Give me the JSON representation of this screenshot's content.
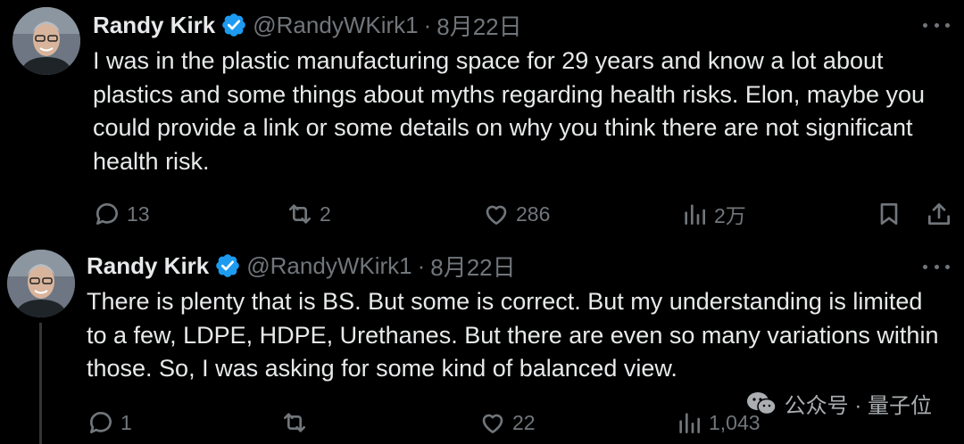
{
  "tweets": [
    {
      "name": "Randy Kirk",
      "handle": "@RandyWKirk1",
      "dot": "·",
      "date": "8月22日",
      "text": "I was in the plastic manufacturing space for 29 years and know a lot about plastics and some things about myths regarding health risks. Elon, maybe you could provide a link or some details on why you think there are not significant health risk.",
      "replies": "13",
      "retweets": "2",
      "likes": "286",
      "views": "2万"
    },
    {
      "name": "Randy Kirk",
      "handle": "@RandyWKirk1",
      "dot": "·",
      "date": "8月22日",
      "text": "There is plenty that is BS. But some is correct. But my understanding is limited to a few, LDPE, HDPE, Urethanes. But there are even so many variations within those. So, I was asking for some kind of balanced view.",
      "replies": "1",
      "retweets": "",
      "likes": "22",
      "views": "1,043"
    }
  ],
  "watermark": {
    "text": "公众号 · 量子位",
    "icon": "wechat-icon"
  },
  "colors": {
    "background": "#000000",
    "text": "#e7e9ea",
    "muted": "#71767b",
    "verified": "#1d9bf0"
  }
}
